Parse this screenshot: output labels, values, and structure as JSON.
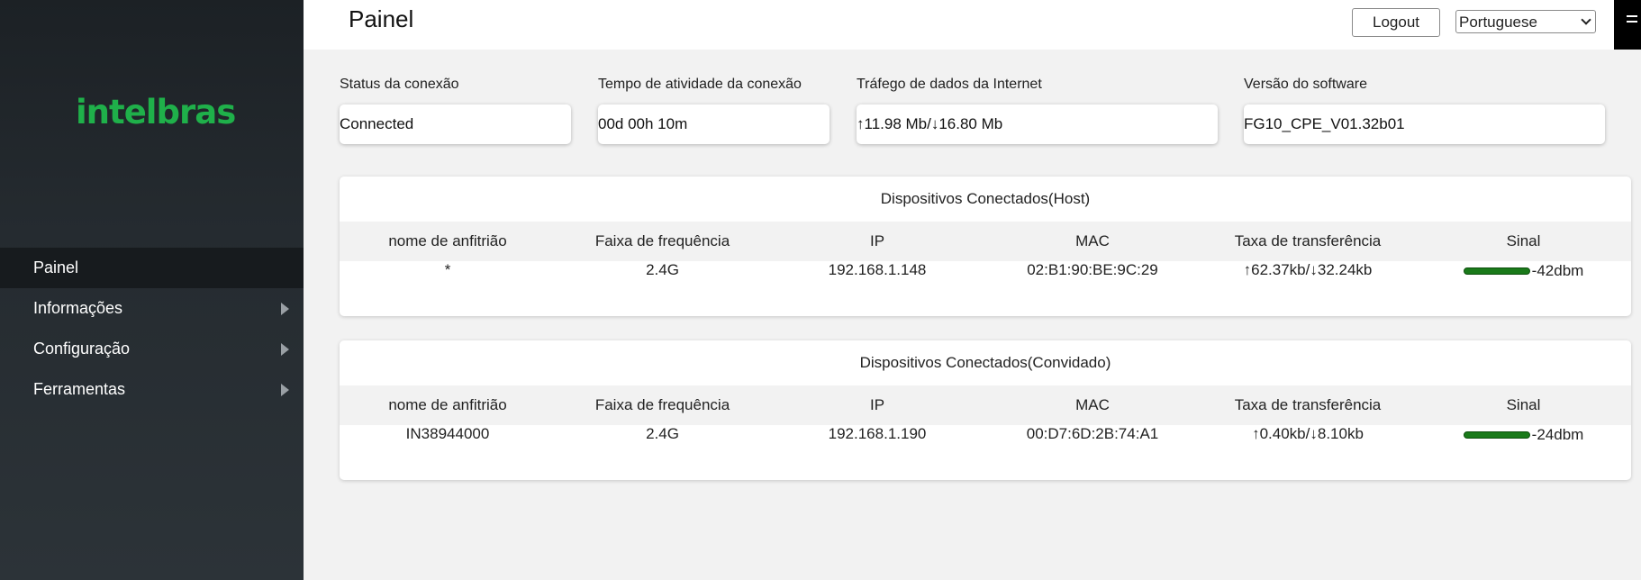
{
  "sidebar": {
    "logo": "intelbras",
    "items": [
      {
        "label": "Painel"
      },
      {
        "label": "Informações"
      },
      {
        "label": "Configuração"
      },
      {
        "label": "Ferramentas"
      }
    ]
  },
  "header": {
    "title": "Painel",
    "logout_label": "Logout",
    "language": "Portuguese"
  },
  "status": [
    {
      "label": "Status da conexão",
      "value": "Connected"
    },
    {
      "label": "Tempo de atividade da conexão",
      "value": "00d 00h 10m"
    },
    {
      "label": "Tráfego de dados da Internet",
      "value": "↑11.98 Mb/↓16.80 Mb"
    },
    {
      "label": "Versão do software",
      "value": "FG10_CPE_V01.32b01"
    }
  ],
  "host_table": {
    "title": "Dispositivos Conectados(Host)",
    "columns": [
      "nome de anfitrião",
      "Faixa de frequência",
      "IP",
      "MAC",
      "Taxa de transferência",
      "Sinal"
    ],
    "rows": [
      {
        "hostname": "*",
        "band": "2.4G",
        "ip": "192.168.1.148",
        "mac": "02:B1:90:BE:9C:29",
        "rate": "↑62.37kb/↓32.24kb",
        "signal": "-42dbm"
      }
    ]
  },
  "guest_table": {
    "title": "Dispositivos Conectados(Convidado)",
    "columns": [
      "nome de anfitrião",
      "Faixa de frequência",
      "IP",
      "MAC",
      "Taxa de transferência",
      "Sinal"
    ],
    "rows": [
      {
        "hostname": "IN38944000",
        "band": "2.4G",
        "ip": "192.168.1.190",
        "mac": "00:D7:6D:2B:74:A1",
        "rate": "↑0.40kb/↓8.10kb",
        "signal": "-24dbm"
      }
    ]
  },
  "colors": {
    "brand": "#1fb04a",
    "sidebar": "#252b30",
    "signal": "#1a7a1a"
  }
}
